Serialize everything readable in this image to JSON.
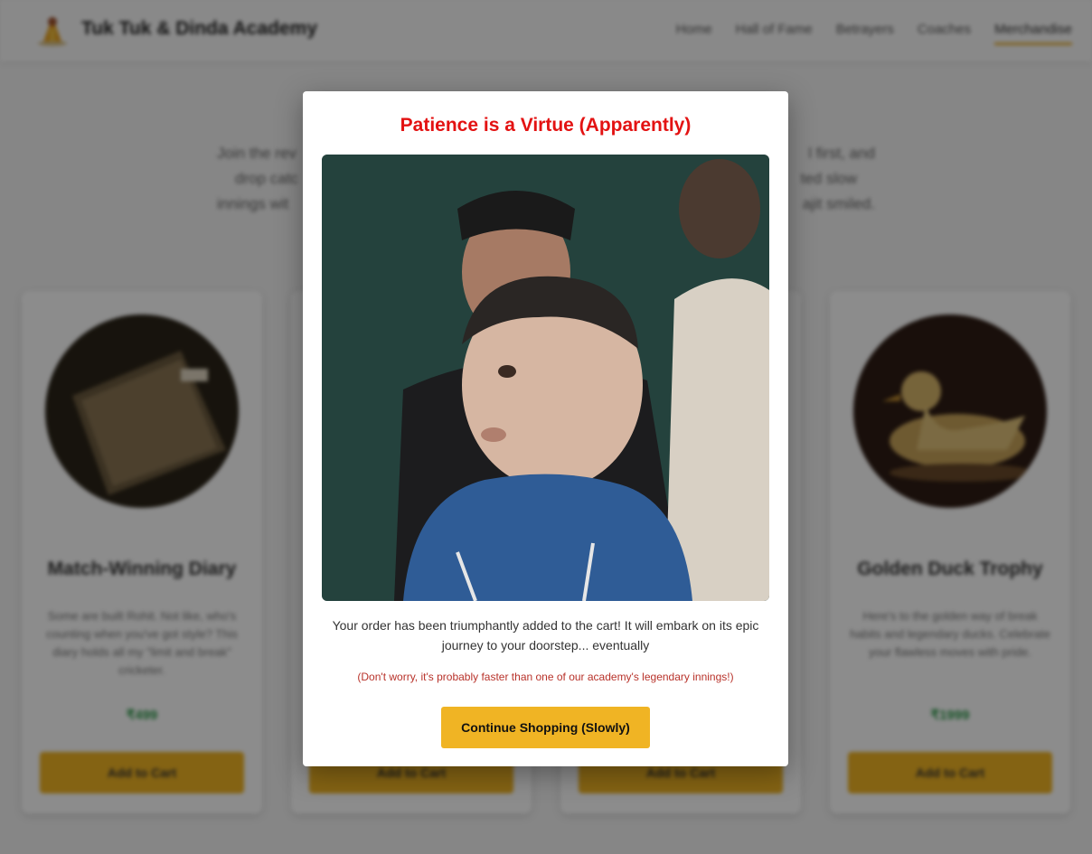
{
  "header": {
    "brand": "Tuk Tuk & Dinda Academy",
    "nav": [
      "Home",
      "Hall of Fame",
      "Betrayers",
      "Coaches",
      "Merchandise"
    ],
    "active_nav": "Merchandise"
  },
  "intro": {
    "line1_left": "Join the rev",
    "line1_right": "l first, and",
    "line2_left": "drop catc",
    "line2_right": "ted slow",
    "line3_left": "innings wit",
    "line3_right": "ajit smiled."
  },
  "products": [
    {
      "name": "Match-Winning Diary",
      "desc": "Some are built Rohit. Not like, who's counting when you've got style? This diary holds all my \"limit and break\" cricketer.",
      "price": "₹499",
      "cart": "Add to Cart"
    },
    {
      "name": "",
      "desc": "",
      "price": "",
      "cart": "Add to Cart"
    },
    {
      "name": "",
      "desc": "",
      "price": "",
      "cart": "Add to Cart"
    },
    {
      "name": "Golden Duck Trophy",
      "desc": "Here's to the golden way of break habits and legendary ducks. Celebrate your flawless moves with pride.",
      "price": "₹1999",
      "cart": "Add to Cart"
    }
  ],
  "modal": {
    "title": "Patience is a Virtue (Apparently)",
    "message": "Your order has been triumphantly added to the cart! It will embark on its epic journey to your doorstep... eventually",
    "note": "(Don't worry, it's probably faster than one of our academy's legendary innings!)",
    "button": "Continue Shopping (Slowly)"
  },
  "colors": {
    "accent": "#f0b424",
    "title_red": "#e31212",
    "note_red": "#b8322a",
    "price_green": "#2d9a4a"
  }
}
